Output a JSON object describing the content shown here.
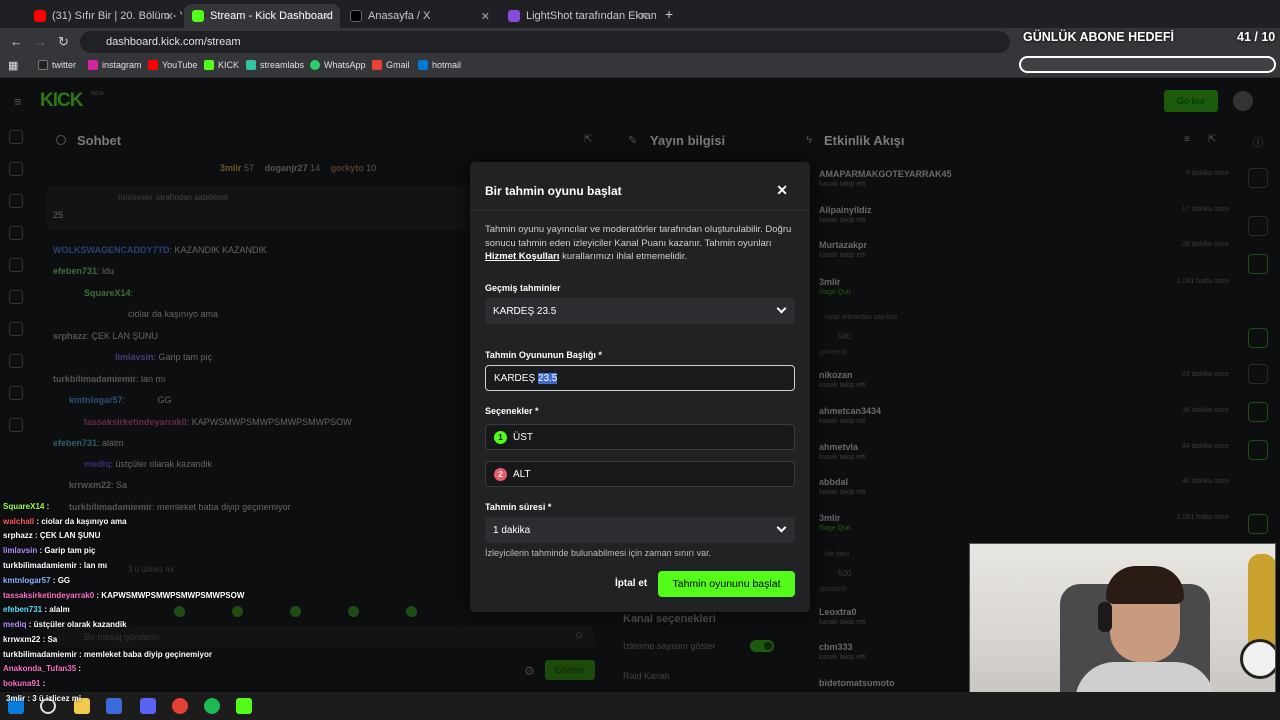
{
  "browser": {
    "tabs": [
      {
        "label": "(31) Sıfır Bir | 20. Bölüm - YouTu",
        "color": "#ff0000",
        "active": false
      },
      {
        "label": "Stream - Kick Dashboard",
        "color": "#53fc18",
        "active": true
      },
      {
        "label": "Anasayfa / X",
        "color": "#000000",
        "active": false
      },
      {
        "label": "LightShot tarafından Ekran Görü",
        "color": "#8a4bd6",
        "active": false
      }
    ],
    "new_tab": "+",
    "url": "dashboard.kick.com/stream",
    "bookmarks": [
      {
        "label": "twitter",
        "color": "#222222"
      },
      {
        "label": "instagram",
        "color": "#d6249f"
      },
      {
        "label": "YouTube",
        "color": "#ff0000"
      },
      {
        "label": "KICK",
        "color": "#53fc18"
      },
      {
        "label": "streamlabs",
        "color": "#31c3a2"
      },
      {
        "label": "WhatsApp",
        "color": "#25d366"
      },
      {
        "label": "Gmail",
        "color": "#ea4335"
      },
      {
        "label": "hotmail",
        "color": "#0078d4"
      }
    ]
  },
  "overlay": {
    "goal_title": "GÜNLÜK ABONE HEDEFİ",
    "goal_count": "41 / 10",
    "goal_progress": 1.0
  },
  "dashboard": {
    "logo": "KICK",
    "beta": "BETA",
    "go_live": "Go live",
    "chat_title": "Sohbet",
    "stream_info_title": "Yayın bilgisi",
    "activity_title": "Etkinlik Akışı",
    "top_users": [
      {
        "name": "3mlir",
        "count": "57"
      },
      {
        "name": "doganjr27",
        "count": "14"
      },
      {
        "name": "gorkyto",
        "count": "10"
      }
    ],
    "pinned_by": "tarafından sabitlendi",
    "pinned_user": "limlavsin",
    "pinned_value": "25",
    "chat_lines": [
      {
        "user": "WOLKSWAGENCADDY7TD",
        "text": "KAZANDIK KAZANDIK"
      },
      {
        "user": "efeben731",
        "text": "ldu"
      },
      {
        "user": "SquareX14",
        "text": ""
      },
      {
        "user": "",
        "text": "ciolar da kaşınıyo ama"
      },
      {
        "user": "srphazz",
        "text": "ÇEK LAN ŞUNU"
      },
      {
        "user": "limlavsin",
        "text": "Garip tam piç"
      },
      {
        "user": "turkbilimadamiemir",
        "text": "lan mı"
      },
      {
        "user": "kmtnlogar57",
        "text": "GG"
      },
      {
        "user": "tassaksirketindeyarrak0",
        "text": "KAPWSMWPSMWPSMWPSMWPSOW"
      },
      {
        "user": "efeben731",
        "text": "alalm"
      },
      {
        "user": "mediq",
        "text": "üstçüler olarak kazandik"
      },
      {
        "user": "krrwxm22",
        "text": "Sa"
      },
      {
        "user": "turkbilimadamiemir",
        "text": "memleket baba diyip geçinemiyor"
      }
    ],
    "chat_placeholder": "Bir mesaj gönderin",
    "send_label": "Gönder",
    "channel_options_title": "Kanal seçenekleri",
    "show_views_label": "İzlenme sayısını göster",
    "raid_label": "Raid Kanalı",
    "events": [
      {
        "name": "AMAPARMAKGOTEYARRAK45",
        "sub": "kanalı takip etti",
        "time": "5 dakika önce"
      },
      {
        "name": "Alipainyildiz",
        "sub": "kanalı takip etti",
        "time": "17 dakika önce"
      },
      {
        "name": "Murtazakpr",
        "sub": "kanalı takip etti",
        "time": "28 dakika önce"
      },
      {
        "name": "3mlir",
        "sub": "Rage Quit",
        "time": "1.061 hafta önce"
      },
      {
        "name": "nikozan",
        "sub": "kanalı takip etti",
        "time": "33 dakika önce"
      },
      {
        "name": "ahmetcan3434",
        "sub": "kanalı takip etti",
        "time": "36 dakika önce"
      },
      {
        "name": "ahmetvla",
        "sub": "kanalı takip etti",
        "time": "44 dakika önce"
      },
      {
        "name": "abbdal",
        "sub": "kanalı takip etti",
        "time": "46 dakika önce"
      },
      {
        "name": "3mlir",
        "sub": "Rage Quit",
        "time": "1.061 hafta önce"
      },
      {
        "name": "Leoxtra0",
        "sub": "kanalı takip etti",
        "time": ""
      },
      {
        "name": "cbm333",
        "sub": "kanalı takip etti",
        "time": ""
      },
      {
        "name": "bidetomatsumoto",
        "sub": "",
        "time": ""
      }
    ],
    "event_note_1": "oylar tekrardan sayılsın",
    "event_note_2": "He dayı",
    "points": "500",
    "sent": "gönderdi"
  },
  "modal": {
    "title": "Bir tahmin oyunu başlat",
    "close": "✕",
    "desc_1": "Tahmin oyunu yayıncılar ve moderatörler tarafından oluşturulabilir. Doğru sonucu tahmin eden izleyiciler Kanal Puanı kazanır. Tahmin oyunları ",
    "desc_link": "Hizmet Koşulları",
    "desc_2": " kurallarımızı ihlal etmemelidir.",
    "past_label": "Geçmiş tahminler",
    "past_value": "KARDEŞ 23.5",
    "title_label": "Tahmin Oyununun Başlığı *",
    "title_value_plain": "KARDEŞ ",
    "title_value_selected": "23.5",
    "options_label": "Seçenekler *",
    "options": [
      {
        "num": "1",
        "text": "ÜST",
        "color": "#53fc18"
      },
      {
        "num": "2",
        "text": "ALT",
        "color": "#e85d6a"
      }
    ],
    "duration_label": "Tahmin süresi *",
    "duration_value": "1 dakika",
    "duration_hint": "İzleyicilerin tahminde bulunabilmesi için zaman sınırı var.",
    "cancel": "İptal et",
    "start": "Tahmin oyununu başlat"
  },
  "stream_overlay_chat": [
    {
      "user": "SquareX14",
      "text": " : ",
      "color": "#9aff4a"
    },
    {
      "user": "walchall",
      "text": " : ciolar da kaşınıyo ama",
      "color": "#ff5a5a"
    },
    {
      "user": "srphazz",
      "text": " : ÇEK LAN ŞUNU",
      "color": "#ffffff"
    },
    {
      "user": "limlavsin",
      "text": " : Garip tam piç",
      "color": "#b48cff"
    },
    {
      "user": "turkbilimadamiemir",
      "text": " : lan mı",
      "color": "#ffffff"
    },
    {
      "user": "kmtnlogar57",
      "text": " : GG",
      "color": "#8ab4ff"
    },
    {
      "user": "tassaksirketindeyarrak0",
      "text": " : KAPWSMWPSMWPSMWPSMWPSOW",
      "color": "#ff6ec7"
    },
    {
      "user": "efeben731",
      "text": " : alalm",
      "color": "#59e0ff"
    },
    {
      "user": "mediq",
      "text": " : üstçüler olarak kazandik",
      "color": "#b48cff"
    },
    {
      "user": "krrwxm22",
      "text": " : Sa",
      "color": "#ffffff"
    },
    {
      "user": "turkbilimadamiemir",
      "text": " : memleket baba diyip geçinemiyor",
      "color": "#ffffff"
    },
    {
      "user": "Anakonda_Tufan35",
      "text": " : ",
      "color": "#ff6ec7"
    },
    {
      "user": "bokuna91",
      "text": " : ",
      "color": "#ff6ec7"
    }
  ],
  "bottom_note": "3mlir : 3 ü izlicez mi",
  "watched_note": "3 ü izlicez mi"
}
